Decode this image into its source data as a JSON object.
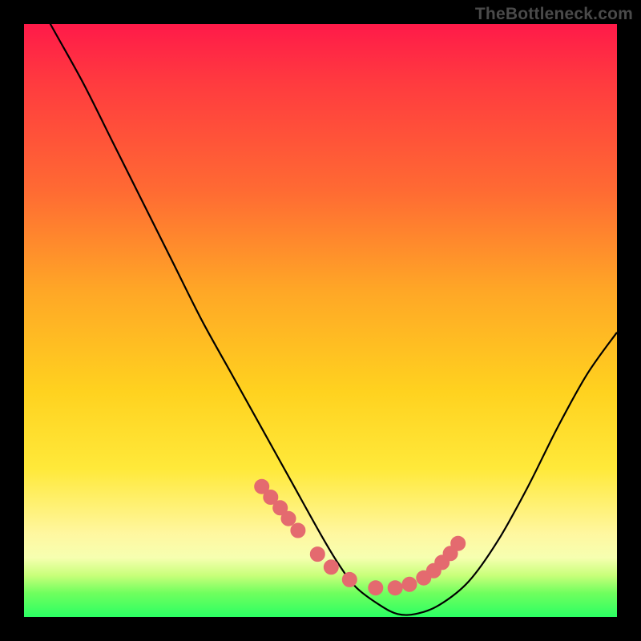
{
  "watermark": "TheBottleneck.com",
  "colors": {
    "curve_stroke": "#000000",
    "marker_fill": "#e46a6f",
    "marker_stroke": "#e46a6f"
  },
  "chart_data": {
    "type": "line",
    "title": "",
    "xlabel": "",
    "ylabel": "",
    "xlim": [
      0,
      100
    ],
    "ylim": [
      0,
      100
    ],
    "series": [
      {
        "name": "bottleneck-curve",
        "x": [
          0,
          5,
          10,
          15,
          20,
          25,
          30,
          35,
          40,
          45,
          50,
          53,
          56,
          60,
          63,
          66,
          70,
          75,
          80,
          85,
          90,
          95,
          100
        ],
        "y": [
          108,
          99,
          90,
          80,
          70,
          60,
          50,
          41,
          32,
          23,
          14,
          9,
          5,
          2,
          0.5,
          0.5,
          2,
          6,
          13,
          22,
          32,
          41,
          48
        ]
      }
    ],
    "markers": {
      "name": "highlight-dots",
      "x_percent": [
        40.1,
        41.6,
        43.2,
        44.6,
        46.2,
        49.5,
        51.8,
        54.9,
        59.3,
        62.6,
        65.0,
        67.4,
        69.1,
        70.5,
        71.9,
        73.2
      ],
      "y_percent": [
        78.0,
        79.8,
        81.6,
        83.4,
        85.4,
        89.4,
        91.6,
        93.7,
        95.1,
        95.1,
        94.5,
        93.4,
        92.2,
        90.8,
        89.3,
        87.6
      ],
      "radius_px": 9
    }
  }
}
